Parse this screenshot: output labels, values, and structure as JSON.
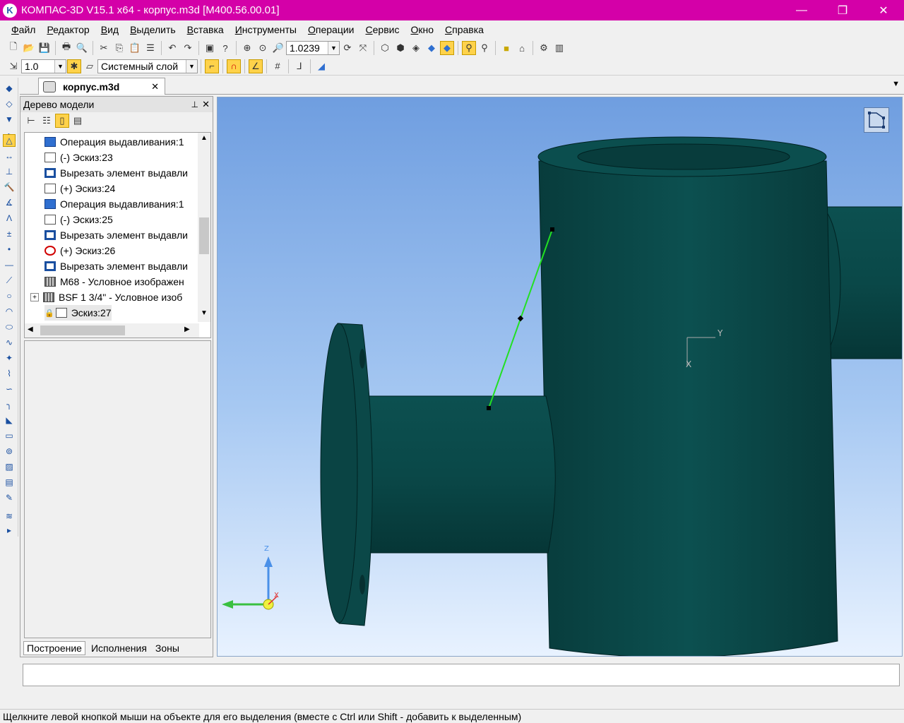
{
  "titlebar": {
    "title": "КОМПАС-3D V15.1 x64 - корпус.m3d [М400.56.00.01]",
    "minimize": "—",
    "maximize": "❐",
    "close": "✕"
  },
  "menu": [
    "Файл",
    "Редактор",
    "Вид",
    "Выделить",
    "Вставка",
    "Инструменты",
    "Операции",
    "Сервис",
    "Окно",
    "Справка"
  ],
  "toolbar": {
    "zoom_value": "1.0239",
    "step_value": "1.0",
    "layer_value": "Системный слой"
  },
  "doc_tab": {
    "label": "корпус.m3d",
    "close": "✕"
  },
  "tree": {
    "title": "Дерево модели",
    "pin": "⊥",
    "close": "✕",
    "items": [
      {
        "label": "Операция выдавливания:1",
        "icon": "extrude-icon"
      },
      {
        "label": "(-) Эскиз:23",
        "icon": "sketch-icon"
      },
      {
        "label": "Вырезать элемент выдавли",
        "icon": "cut-icon"
      },
      {
        "label": "(+) Эскиз:24",
        "icon": "sketch-icon"
      },
      {
        "label": "Операция выдавливания:1",
        "icon": "extrude-icon"
      },
      {
        "label": "(-) Эскиз:25",
        "icon": "sketch-icon"
      },
      {
        "label": "Вырезать элемент выдавли",
        "icon": "cut-icon"
      },
      {
        "label": "(+) Эскиз:26",
        "icon": "error-sketch-icon"
      },
      {
        "label": "Вырезать элемент выдавли",
        "icon": "cut-icon"
      },
      {
        "label": "M68 - Условное изображен",
        "icon": "thread-icon"
      },
      {
        "label": "BSF 1 3/4\" - Условное изоб",
        "icon": "thread-icon"
      },
      {
        "label": "Эскиз:27",
        "icon": "sketch-icon"
      }
    ],
    "tabs": [
      "Построение",
      "Исполнения",
      "Зоны"
    ]
  },
  "viewport": {
    "axis_y": "Y",
    "axis_x": "X",
    "triad_z": "Z",
    "triad_x": "X"
  },
  "status": {
    "message": "Щелкните левой кнопкой мыши на объекте для его выделения (вместе с Ctrl или Shift - добавить к выделенным)"
  },
  "colors": {
    "titlebar": "#d400a8",
    "model": "#0a4a4a",
    "highlight": "#ffd24a",
    "selection_line": "#22e022"
  }
}
